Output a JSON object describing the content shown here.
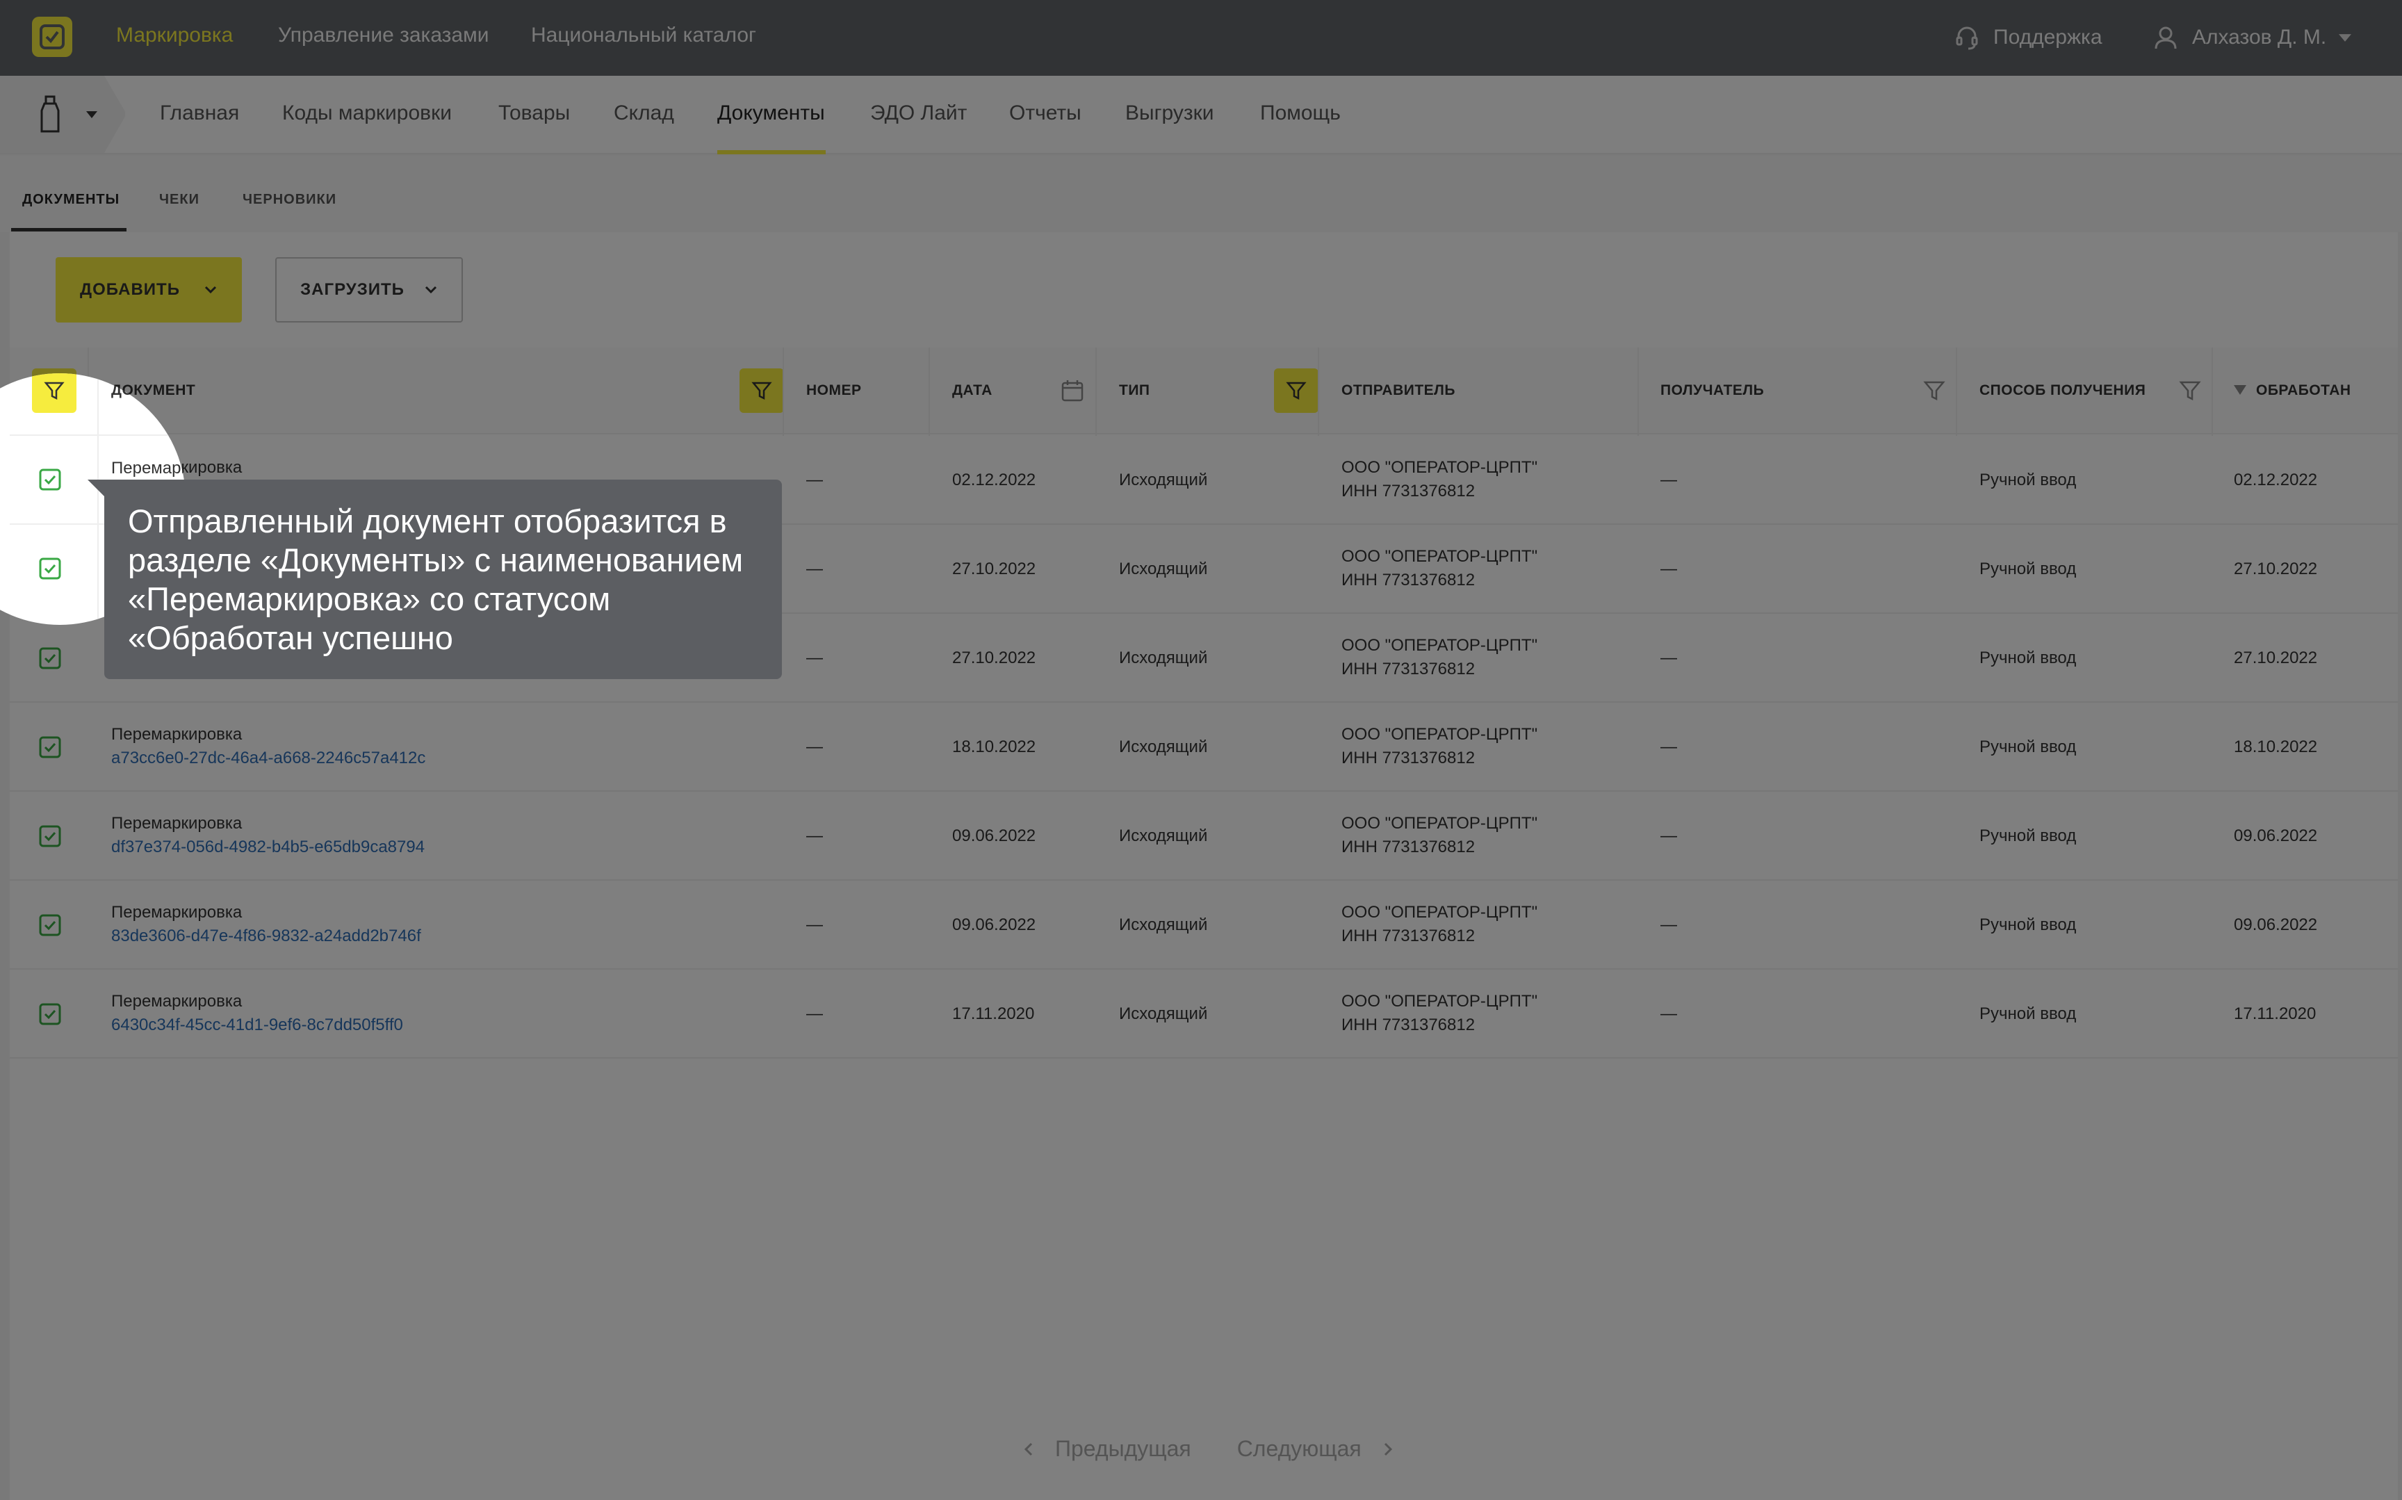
{
  "topbar": {
    "nav": [
      "Маркировка",
      "Управление заказами",
      "Национальный каталог"
    ],
    "support_label": "Поддержка",
    "user_name": "Алхазов Д. М."
  },
  "secnav": {
    "items": [
      "Главная",
      "Коды маркировки",
      "Товары",
      "Склад",
      "Документы",
      "ЭДО Лайт",
      "Отчеты",
      "Выгрузки",
      "Помощь"
    ],
    "active": "Документы"
  },
  "subtabs": [
    "ДОКУМЕНТЫ",
    "ЧЕКИ",
    "ЧЕРНОВИКИ"
  ],
  "toolbar": {
    "add_label": "ДОБАВИТЬ",
    "load_label": "ЗАГРУЗИТЬ"
  },
  "table": {
    "columns": [
      "ДОКУМЕНТ",
      "НОМЕР",
      "ДАТА",
      "ТИП",
      "ОТПРАВИТЕЛЬ",
      "ПОЛУЧАТЕЛЬ",
      "СПОСОБ ПОЛУЧЕНИЯ",
      "ОБРАБОТАН"
    ],
    "rows": [
      {
        "doc": "Перемаркировка",
        "id": "",
        "number": "—",
        "date": "02.12.2022",
        "type": "Исходящий",
        "sender1": "ООО \"ОПЕРАТОР-ЦРПТ\"",
        "sender2": "ИНН 7731376812",
        "receiver": "—",
        "method": "Ручной ввод",
        "processed": "02.12.2022"
      },
      {
        "doc": "",
        "id": "",
        "number": "—",
        "date": "27.10.2022",
        "type": "Исходящий",
        "sender1": "ООО \"ОПЕРАТОР-ЦРПТ\"",
        "sender2": "ИНН 7731376812",
        "receiver": "—",
        "method": "Ручной ввод",
        "processed": "27.10.2022"
      },
      {
        "doc": "",
        "id": "",
        "number": "—",
        "date": "27.10.2022",
        "type": "Исходящий",
        "sender1": "ООО \"ОПЕРАТОР-ЦРПТ\"",
        "sender2": "ИНН 7731376812",
        "receiver": "—",
        "method": "Ручной ввод",
        "processed": "27.10.2022"
      },
      {
        "doc": "Перемаркировка",
        "id": "a73cc6e0-27dc-46a4-a668-2246c57a412c",
        "number": "—",
        "date": "18.10.2022",
        "type": "Исходящий",
        "sender1": "ООО \"ОПЕРАТОР-ЦРПТ\"",
        "sender2": "ИНН 7731376812",
        "receiver": "—",
        "method": "Ручной ввод",
        "processed": "18.10.2022"
      },
      {
        "doc": "Перемаркировка",
        "id": "df37e374-056d-4982-b4b5-e65db9ca8794",
        "number": "—",
        "date": "09.06.2022",
        "type": "Исходящий",
        "sender1": "ООО \"ОПЕРАТОР-ЦРПТ\"",
        "sender2": "ИНН 7731376812",
        "receiver": "—",
        "method": "Ручной ввод",
        "processed": "09.06.2022"
      },
      {
        "doc": "Перемаркировка",
        "id": "83de3606-d47e-4f86-9832-a24add2b746f",
        "number": "—",
        "date": "09.06.2022",
        "type": "Исходящий",
        "sender1": "ООО \"ОПЕРАТОР-ЦРПТ\"",
        "sender2": "ИНН 7731376812",
        "receiver": "—",
        "method": "Ручной ввод",
        "processed": "09.06.2022"
      },
      {
        "doc": "Перемаркировка",
        "id": "6430c34f-45cc-41d1-9ef6-8c7dd50f5ff0",
        "number": "—",
        "date": "17.11.2020",
        "type": "Исходящий",
        "sender1": "ООО \"ОПЕРАТОР-ЦРПТ\"",
        "sender2": "ИНН 7731376812",
        "receiver": "—",
        "method": "Ручной ввод",
        "processed": "17.11.2020"
      }
    ]
  },
  "pagination": {
    "prev": "Предыдущая",
    "next": "Следующая"
  },
  "tooltip": {
    "text": "Отправленный документ отобразится в разделе «Документы» с наименованием «Перемаркировка» со статусом «Обработан успешно"
  },
  "colors": {
    "accent": "#f6ec3e",
    "link": "#2e6db4",
    "check": "#3aa845",
    "header_bg": "#63666a"
  }
}
